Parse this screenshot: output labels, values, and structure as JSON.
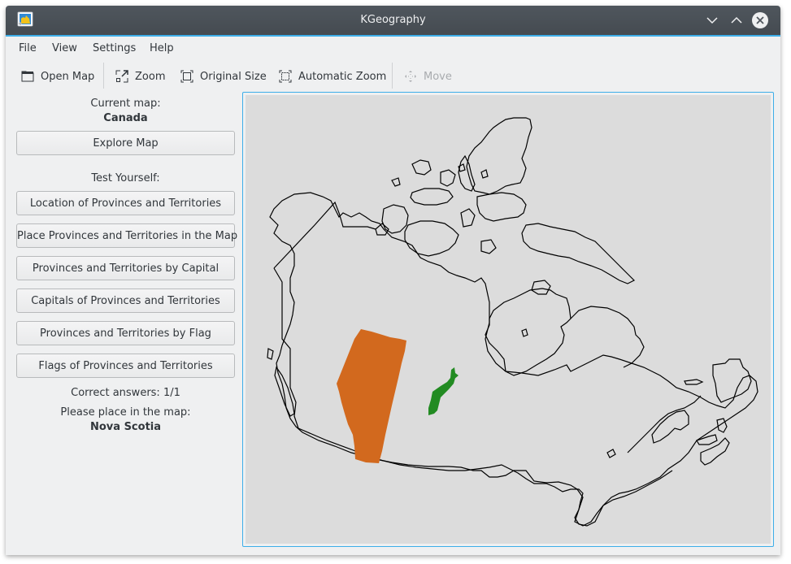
{
  "window": {
    "title": "KGeography",
    "icons": {
      "app": "kgeography-app-icon",
      "minimize": "chevron-down-icon",
      "maximize": "chevron-up-icon",
      "close": "close-icon"
    }
  },
  "menubar": {
    "items": [
      {
        "label": "File"
      },
      {
        "label": "View"
      },
      {
        "label": "Settings"
      },
      {
        "label": "Help"
      }
    ]
  },
  "toolbar": {
    "items": [
      {
        "label": "Open Map",
        "icon": "folder-icon",
        "enabled": true
      },
      {
        "label": "Zoom",
        "icon": "zoom-select-icon",
        "enabled": true
      },
      {
        "label": "Original Size",
        "icon": "original-size-icon",
        "enabled": true
      },
      {
        "label": "Automatic Zoom",
        "icon": "auto-zoom-icon",
        "enabled": true
      },
      {
        "label": "Move",
        "icon": "move-icon",
        "enabled": false
      }
    ]
  },
  "sidebar": {
    "current_map_label": "Current map:",
    "current_map": "Canada",
    "explore_button": "Explore Map",
    "test_yourself_label": "Test Yourself:",
    "test_buttons": [
      {
        "label": "Location of Provinces and Territories"
      },
      {
        "label": "Place Provinces and Territories in the Map"
      },
      {
        "label": "Provinces and Territories by Capital"
      },
      {
        "label": "Capitals of Provinces and Territories"
      },
      {
        "label": "Provinces and Territories by Flag"
      },
      {
        "label": "Flags of Provinces and Territories"
      }
    ],
    "correct_answers": "Correct answers: 1/1",
    "prompt_label": "Please place in the map:",
    "prompt_target": "Nova Scotia"
  },
  "map": {
    "name": "Canada",
    "background_color": "#dcdcdc",
    "outline_color": "#000000",
    "placed_regions": [
      {
        "name": "Alberta",
        "color": "#d2691e",
        "status": "placed"
      },
      {
        "name": "Nova Scotia",
        "color": "#228b22",
        "status": "being placed"
      }
    ]
  }
}
